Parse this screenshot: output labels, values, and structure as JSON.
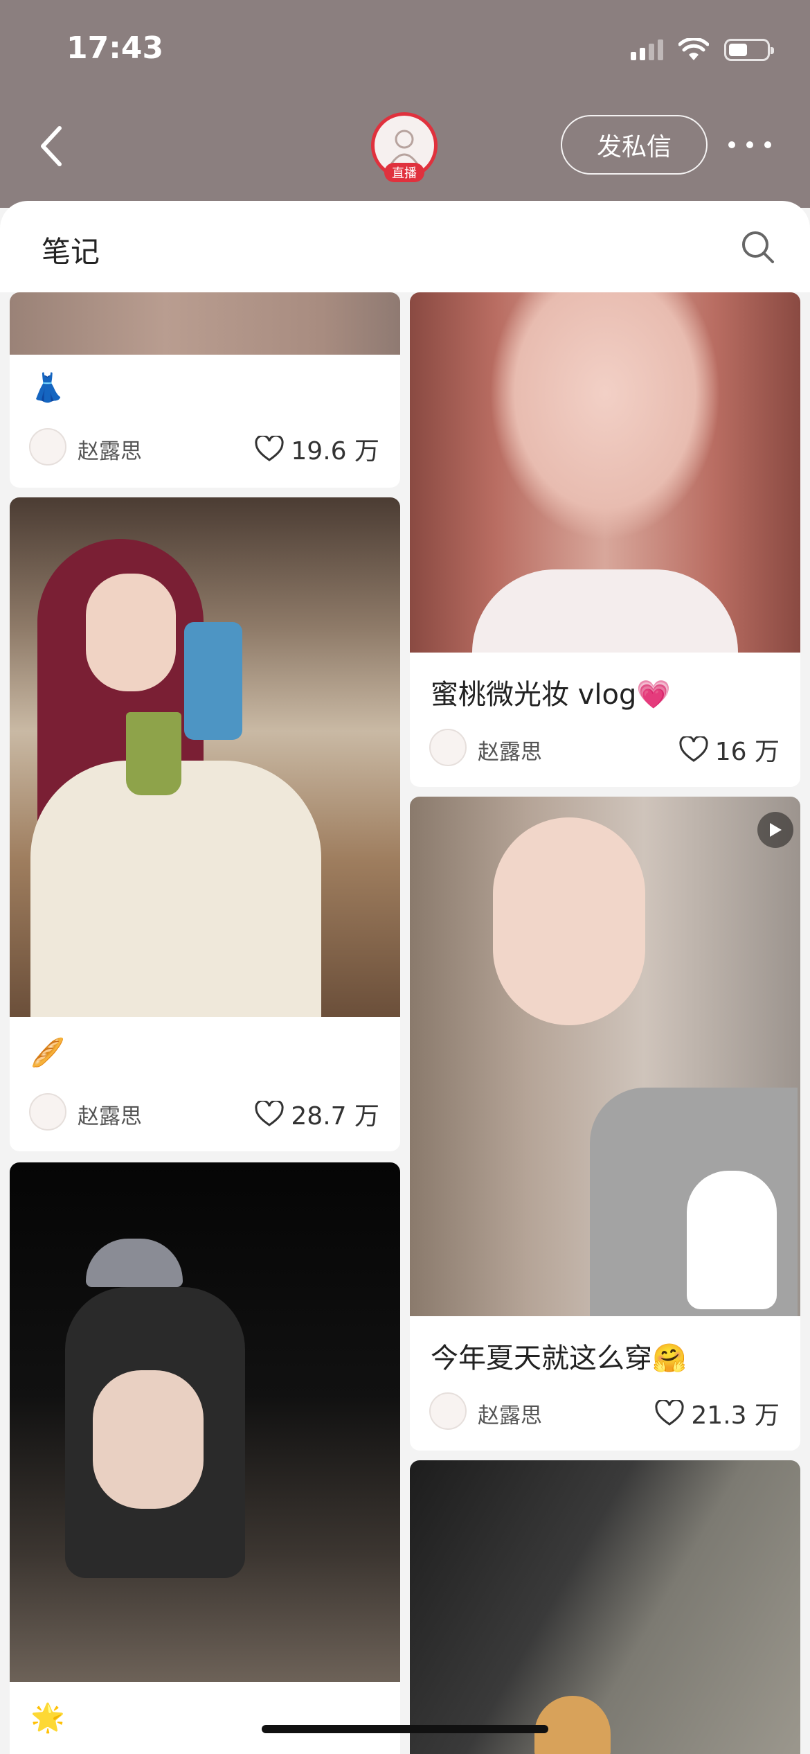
{
  "status_bar": {
    "time": "17:43"
  },
  "header": {
    "dm_label": "发私信",
    "live_badge": "直播"
  },
  "sheet": {
    "title": "笔记"
  },
  "notes": [
    {
      "title": "👗",
      "author": "赵露思",
      "likes": "19.6 万"
    },
    {
      "title": "蜜桃微光妆 vlog💗",
      "author": "赵露思",
      "likes": "16 万"
    },
    {
      "title": "🥖",
      "author": "赵露思",
      "likes": "28.7 万"
    },
    {
      "title": "今年夏天就这么穿🤗",
      "author": "赵露思",
      "likes": "21.3 万"
    },
    {
      "title": "🌟"
    }
  ],
  "colors": {
    "header_bg": "#8b7f7f",
    "live_red": "#e0313d",
    "page_bg": "#f3f3f3"
  },
  "icons": [
    "back-chevron-icon",
    "signal-icon",
    "wifi-icon",
    "battery-icon",
    "more-dots-icon",
    "search-icon",
    "heart-icon",
    "play-icon"
  ]
}
